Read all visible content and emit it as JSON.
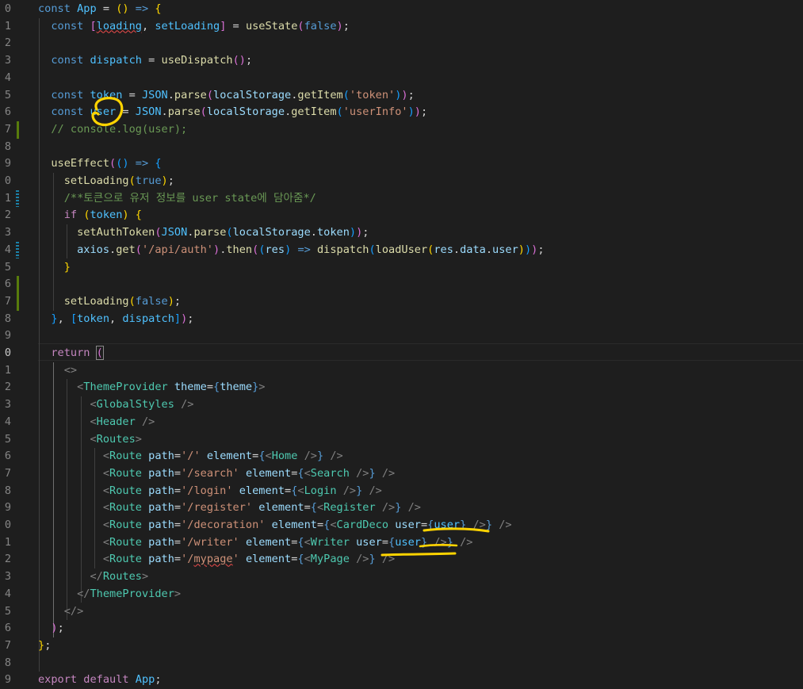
{
  "editor": {
    "line_numbers": [
      "0",
      "1",
      "2",
      "3",
      "4",
      "5",
      "6",
      "7",
      "8",
      "9",
      "0",
      "1",
      "2",
      "3",
      "4",
      "5",
      "6",
      "7",
      "8",
      "9",
      "0",
      "1",
      "2",
      "3",
      "4",
      "5",
      "6",
      "7",
      "8",
      "9",
      "0",
      "1",
      "2",
      "3",
      "4",
      "5",
      "6",
      "7",
      "8",
      "9"
    ],
    "active_line_index": 20,
    "lines": [
      [
        [
          "kw",
          "const "
        ],
        [
          "const",
          "App"
        ],
        [
          "txt",
          " = "
        ],
        [
          "br1",
          "()"
        ],
        [
          "txt",
          " "
        ],
        [
          "kw",
          "=>"
        ],
        [
          "txt",
          " "
        ],
        [
          "br1",
          "{"
        ]
      ],
      [
        [
          "txt",
          "  "
        ],
        [
          "kw",
          "const "
        ],
        [
          "br2",
          "["
        ],
        [
          "const",
          "loading",
          "squig"
        ],
        [
          "txt",
          ", "
        ],
        [
          "const",
          "setLoading"
        ],
        [
          "br2",
          "]"
        ],
        [
          "txt",
          " = "
        ],
        [
          "fn",
          "useState"
        ],
        [
          "br2",
          "("
        ],
        [
          "kw",
          "false"
        ],
        [
          "br2",
          ")"
        ],
        [
          "txt",
          ";"
        ]
      ],
      [],
      [
        [
          "txt",
          "  "
        ],
        [
          "kw",
          "const "
        ],
        [
          "const",
          "dispatch"
        ],
        [
          "txt",
          " = "
        ],
        [
          "fn",
          "useDispatch"
        ],
        [
          "br2",
          "()"
        ],
        [
          "txt",
          ";"
        ]
      ],
      [],
      [
        [
          "txt",
          "  "
        ],
        [
          "kw",
          "const "
        ],
        [
          "const",
          "token"
        ],
        [
          "txt",
          " = "
        ],
        [
          "const",
          "JSON"
        ],
        [
          "txt",
          "."
        ],
        [
          "fn",
          "parse"
        ],
        [
          "br2",
          "("
        ],
        [
          "var",
          "localStorage"
        ],
        [
          "txt",
          "."
        ],
        [
          "fn",
          "getItem"
        ],
        [
          "br3",
          "("
        ],
        [
          "str",
          "'token'"
        ],
        [
          "br3",
          ")"
        ],
        [
          "br2",
          ")"
        ],
        [
          "txt",
          ";"
        ]
      ],
      [
        [
          "txt",
          "  "
        ],
        [
          "kw",
          "const "
        ],
        [
          "const",
          "user"
        ],
        [
          "txt",
          " = "
        ],
        [
          "const",
          "JSON"
        ],
        [
          "txt",
          "."
        ],
        [
          "fn",
          "parse"
        ],
        [
          "br2",
          "("
        ],
        [
          "var",
          "localStorage"
        ],
        [
          "txt",
          "."
        ],
        [
          "fn",
          "getItem"
        ],
        [
          "br3",
          "("
        ],
        [
          "str",
          "'userInfo'"
        ],
        [
          "br3",
          ")"
        ],
        [
          "br2",
          ")"
        ],
        [
          "txt",
          ";"
        ]
      ],
      [
        [
          "txt",
          "  "
        ],
        [
          "cmt",
          "// console.log(user);"
        ]
      ],
      [],
      [
        [
          "txt",
          "  "
        ],
        [
          "fn",
          "useEffect"
        ],
        [
          "br2",
          "("
        ],
        [
          "br3",
          "()"
        ],
        [
          "txt",
          " "
        ],
        [
          "kw",
          "=>"
        ],
        [
          "txt",
          " "
        ],
        [
          "br3",
          "{"
        ]
      ],
      [
        [
          "txt",
          "    "
        ],
        [
          "fn",
          "setLoading"
        ],
        [
          "br1",
          "("
        ],
        [
          "kw",
          "true"
        ],
        [
          "br1",
          ")"
        ],
        [
          "txt",
          ";"
        ]
      ],
      [
        [
          "txt",
          "    "
        ],
        [
          "cmt",
          "/**토큰으로 유저 정보를 user state에 담아줌*/"
        ]
      ],
      [
        [
          "txt",
          "    "
        ],
        [
          "ctrl",
          "if"
        ],
        [
          "txt",
          " "
        ],
        [
          "br1",
          "("
        ],
        [
          "const",
          "token"
        ],
        [
          "br1",
          ")"
        ],
        [
          "txt",
          " "
        ],
        [
          "br1",
          "{"
        ]
      ],
      [
        [
          "txt",
          "      "
        ],
        [
          "fn",
          "setAuthToken"
        ],
        [
          "br2",
          "("
        ],
        [
          "const",
          "JSON"
        ],
        [
          "txt",
          "."
        ],
        [
          "fn",
          "parse"
        ],
        [
          "br3",
          "("
        ],
        [
          "var",
          "localStorage"
        ],
        [
          "txt",
          "."
        ],
        [
          "var",
          "token"
        ],
        [
          "br3",
          ")"
        ],
        [
          "br2",
          ")"
        ],
        [
          "txt",
          ";"
        ]
      ],
      [
        [
          "txt",
          "      "
        ],
        [
          "var",
          "axios"
        ],
        [
          "txt",
          "."
        ],
        [
          "fn",
          "get"
        ],
        [
          "br2",
          "("
        ],
        [
          "str",
          "'/api/auth'"
        ],
        [
          "br2",
          ")"
        ],
        [
          "txt",
          "."
        ],
        [
          "fn",
          "then"
        ],
        [
          "br2",
          "("
        ],
        [
          "br3",
          "("
        ],
        [
          "var",
          "res"
        ],
        [
          "br3",
          ")"
        ],
        [
          "txt",
          " "
        ],
        [
          "kw",
          "=>"
        ],
        [
          "txt",
          " "
        ],
        [
          "fn",
          "dispatch"
        ],
        [
          "br3",
          "("
        ],
        [
          "fn",
          "loadUser"
        ],
        [
          "br1",
          "("
        ],
        [
          "var",
          "res"
        ],
        [
          "txt",
          "."
        ],
        [
          "var",
          "data"
        ],
        [
          "txt",
          "."
        ],
        [
          "var",
          "user"
        ],
        [
          "br1",
          ")"
        ],
        [
          "br3",
          ")"
        ],
        [
          "br2",
          ")"
        ],
        [
          "txt",
          ";"
        ]
      ],
      [
        [
          "txt",
          "    "
        ],
        [
          "br1",
          "}"
        ]
      ],
      [],
      [
        [
          "txt",
          "    "
        ],
        [
          "fn",
          "setLoading"
        ],
        [
          "br1",
          "("
        ],
        [
          "kw",
          "false"
        ],
        [
          "br1",
          ")"
        ],
        [
          "txt",
          ";"
        ]
      ],
      [
        [
          "txt",
          "  "
        ],
        [
          "br3",
          "}"
        ],
        [
          "txt",
          ", "
        ],
        [
          "br3",
          "["
        ],
        [
          "const",
          "token"
        ],
        [
          "txt",
          ", "
        ],
        [
          "const",
          "dispatch"
        ],
        [
          "br3",
          "]"
        ],
        [
          "br2",
          ")"
        ],
        [
          "txt",
          ";"
        ]
      ],
      [],
      [
        [
          "txt",
          "  "
        ],
        [
          "ctrl",
          "return"
        ],
        [
          "txt",
          " "
        ],
        [
          "br2",
          "(",
          "match"
        ]
      ],
      [
        [
          "txt",
          "    "
        ],
        [
          "punc",
          "<>"
        ]
      ],
      [
        [
          "txt",
          "      "
        ],
        [
          "punc",
          "<"
        ],
        [
          "tag",
          "ThemeProvider"
        ],
        [
          "txt",
          " "
        ],
        [
          "var",
          "theme"
        ],
        [
          "txt",
          "="
        ],
        [
          "kw",
          "{"
        ],
        [
          "var",
          "theme"
        ],
        [
          "kw",
          "}"
        ],
        [
          "punc",
          ">"
        ]
      ],
      [
        [
          "txt",
          "        "
        ],
        [
          "punc",
          "<"
        ],
        [
          "tag",
          "GlobalStyles"
        ],
        [
          "txt",
          " "
        ],
        [
          "punc",
          "/>"
        ]
      ],
      [
        [
          "txt",
          "        "
        ],
        [
          "punc",
          "<"
        ],
        [
          "tag",
          "Header"
        ],
        [
          "txt",
          " "
        ],
        [
          "punc",
          "/>"
        ]
      ],
      [
        [
          "txt",
          "        "
        ],
        [
          "punc",
          "<"
        ],
        [
          "tag",
          "Routes"
        ],
        [
          "punc",
          ">"
        ]
      ],
      [
        [
          "txt",
          "          "
        ],
        [
          "punc",
          "<"
        ],
        [
          "tag",
          "Route"
        ],
        [
          "txt",
          " "
        ],
        [
          "var",
          "path"
        ],
        [
          "txt",
          "="
        ],
        [
          "str",
          "'/'"
        ],
        [
          "txt",
          " "
        ],
        [
          "var",
          "element"
        ],
        [
          "txt",
          "="
        ],
        [
          "kw",
          "{"
        ],
        [
          "punc",
          "<"
        ],
        [
          "tag",
          "Home"
        ],
        [
          "txt",
          " "
        ],
        [
          "punc",
          "/>"
        ],
        [
          "kw",
          "}"
        ],
        [
          "txt",
          " "
        ],
        [
          "punc",
          "/>"
        ]
      ],
      [
        [
          "txt",
          "          "
        ],
        [
          "punc",
          "<"
        ],
        [
          "tag",
          "Route"
        ],
        [
          "txt",
          " "
        ],
        [
          "var",
          "path"
        ],
        [
          "txt",
          "="
        ],
        [
          "str",
          "'/search'"
        ],
        [
          "txt",
          " "
        ],
        [
          "var",
          "element"
        ],
        [
          "txt",
          "="
        ],
        [
          "kw",
          "{"
        ],
        [
          "punc",
          "<"
        ],
        [
          "tag",
          "Search"
        ],
        [
          "txt",
          " "
        ],
        [
          "punc",
          "/>"
        ],
        [
          "kw",
          "}"
        ],
        [
          "txt",
          " "
        ],
        [
          "punc",
          "/>"
        ]
      ],
      [
        [
          "txt",
          "          "
        ],
        [
          "punc",
          "<"
        ],
        [
          "tag",
          "Route"
        ],
        [
          "txt",
          " "
        ],
        [
          "var",
          "path"
        ],
        [
          "txt",
          "="
        ],
        [
          "str",
          "'/login'"
        ],
        [
          "txt",
          " "
        ],
        [
          "var",
          "element"
        ],
        [
          "txt",
          "="
        ],
        [
          "kw",
          "{"
        ],
        [
          "punc",
          "<"
        ],
        [
          "tag",
          "Login"
        ],
        [
          "txt",
          " "
        ],
        [
          "punc",
          "/>"
        ],
        [
          "kw",
          "}"
        ],
        [
          "txt",
          " "
        ],
        [
          "punc",
          "/>"
        ]
      ],
      [
        [
          "txt",
          "          "
        ],
        [
          "punc",
          "<"
        ],
        [
          "tag",
          "Route"
        ],
        [
          "txt",
          " "
        ],
        [
          "var",
          "path"
        ],
        [
          "txt",
          "="
        ],
        [
          "str",
          "'/register'"
        ],
        [
          "txt",
          " "
        ],
        [
          "var",
          "element"
        ],
        [
          "txt",
          "="
        ],
        [
          "kw",
          "{"
        ],
        [
          "punc",
          "<"
        ],
        [
          "tag",
          "Register"
        ],
        [
          "txt",
          " "
        ],
        [
          "punc",
          "/>"
        ],
        [
          "kw",
          "}"
        ],
        [
          "txt",
          " "
        ],
        [
          "punc",
          "/>"
        ]
      ],
      [
        [
          "txt",
          "          "
        ],
        [
          "punc",
          "<"
        ],
        [
          "tag",
          "Route"
        ],
        [
          "txt",
          " "
        ],
        [
          "var",
          "path"
        ],
        [
          "txt",
          "="
        ],
        [
          "str",
          "'/decoration'"
        ],
        [
          "txt",
          " "
        ],
        [
          "var",
          "element"
        ],
        [
          "txt",
          "="
        ],
        [
          "kw",
          "{"
        ],
        [
          "punc",
          "<"
        ],
        [
          "tag",
          "CardDeco"
        ],
        [
          "txt",
          " "
        ],
        [
          "var",
          "user"
        ],
        [
          "txt",
          "="
        ],
        [
          "kw",
          "{"
        ],
        [
          "const",
          "user"
        ],
        [
          "kw",
          "}"
        ],
        [
          "txt",
          " "
        ],
        [
          "punc",
          "/>"
        ],
        [
          "kw",
          "}"
        ],
        [
          "txt",
          " "
        ],
        [
          "punc",
          "/>"
        ]
      ],
      [
        [
          "txt",
          "          "
        ],
        [
          "punc",
          "<"
        ],
        [
          "tag",
          "Route"
        ],
        [
          "txt",
          " "
        ],
        [
          "var",
          "path"
        ],
        [
          "txt",
          "="
        ],
        [
          "str",
          "'/writer'"
        ],
        [
          "txt",
          " "
        ],
        [
          "var",
          "element"
        ],
        [
          "txt",
          "="
        ],
        [
          "kw",
          "{"
        ],
        [
          "punc",
          "<"
        ],
        [
          "tag",
          "Writer"
        ],
        [
          "txt",
          " "
        ],
        [
          "var",
          "user"
        ],
        [
          "txt",
          "="
        ],
        [
          "kw",
          "{"
        ],
        [
          "const",
          "user"
        ],
        [
          "kw",
          "}"
        ],
        [
          "txt",
          " "
        ],
        [
          "punc",
          "/>"
        ],
        [
          "kw",
          "}"
        ],
        [
          "txt",
          " "
        ],
        [
          "punc",
          "/>"
        ]
      ],
      [
        [
          "txt",
          "          "
        ],
        [
          "punc",
          "<"
        ],
        [
          "tag",
          "Route"
        ],
        [
          "txt",
          " "
        ],
        [
          "var",
          "path"
        ],
        [
          "txt",
          "="
        ],
        [
          "str",
          "'/"
        ],
        [
          "str",
          "mypage",
          "squig"
        ],
        [
          "str",
          "'"
        ],
        [
          "txt",
          " "
        ],
        [
          "var",
          "element"
        ],
        [
          "txt",
          "="
        ],
        [
          "kw",
          "{"
        ],
        [
          "punc",
          "<"
        ],
        [
          "tag",
          "MyPage"
        ],
        [
          "txt",
          " "
        ],
        [
          "punc",
          "/>"
        ],
        [
          "kw",
          "}"
        ],
        [
          "txt",
          " "
        ],
        [
          "punc",
          "/>"
        ]
      ],
      [
        [
          "txt",
          "        "
        ],
        [
          "punc",
          "</"
        ],
        [
          "tag",
          "Routes"
        ],
        [
          "punc",
          ">"
        ]
      ],
      [
        [
          "txt",
          "      "
        ],
        [
          "punc",
          "</"
        ],
        [
          "tag",
          "ThemeProvider"
        ],
        [
          "punc",
          ">"
        ]
      ],
      [
        [
          "txt",
          "    "
        ],
        [
          "punc",
          "</>"
        ]
      ],
      [
        [
          "txt",
          "  "
        ],
        [
          "br2",
          ")"
        ],
        [
          "txt",
          ";"
        ]
      ],
      [
        [
          "br1",
          "}"
        ],
        [
          "txt",
          ";"
        ]
      ],
      [],
      [
        [
          "ctrl",
          "export"
        ],
        [
          "txt",
          " "
        ],
        [
          "ctrl",
          "default"
        ],
        [
          "txt",
          " "
        ],
        [
          "const",
          "App"
        ],
        [
          "txt",
          ";"
        ]
      ]
    ],
    "gutter_modified_lines": [
      7,
      16,
      17
    ],
    "gutter_changed_lines": [
      11,
      14
    ],
    "colors": {
      "background": "#1e1e1e",
      "line_number": "#858585",
      "active_line_number": "#c6c6c6",
      "added_marker": "#587c0c",
      "changed_marker": "#1b81a8",
      "annotation_ink": "#ffd400"
    }
  }
}
